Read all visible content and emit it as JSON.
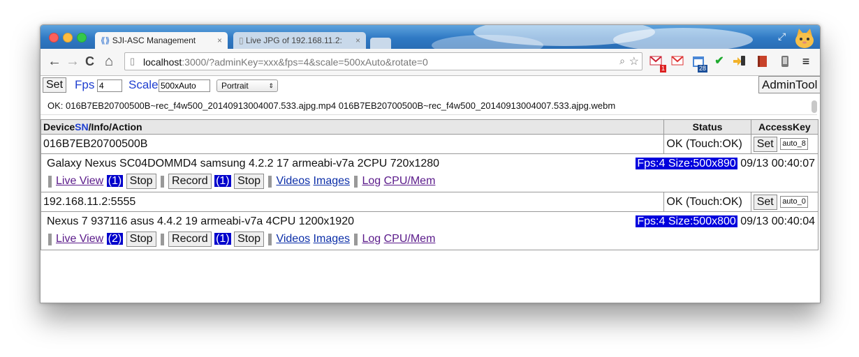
{
  "browser": {
    "tabs": [
      {
        "title": "SJI-ASC Management"
      },
      {
        "title": "Live JPG of 192.168.11.2:"
      }
    ],
    "url_host": "localhost",
    "url_rest": ":3000/?adminKey=xxx&fps=4&scale=500xAuto&rotate=0",
    "nav": {
      "back": "←",
      "forward": "→",
      "reload": "C",
      "home": "⌂"
    },
    "extensions": [
      "gmail-notifier-icon",
      "gmail-icon",
      "calendar-icon",
      "checkmark-icon",
      "phone-sync-icon",
      "book-icon",
      "phone-icon",
      "menu-icon"
    ],
    "badges": {
      "gmail": "1",
      "calendar": "28"
    }
  },
  "controls": {
    "set_label": "Set",
    "fps_label": "Fps",
    "fps_value": "4",
    "scale_label": "Scale",
    "scale_value": "500xAuto",
    "orientation": "Portrait",
    "admin_tool_label": "AdminTool"
  },
  "status_message": "OK: 016B7EB20700500B~rec_f4w500_20140913004007.533.ajpg.mp4 016B7EB20700500B~rec_f4w500_20140913004007.533.ajpg.webm",
  "table": {
    "headers": {
      "device_prefix": "Device",
      "device_sn": "SN",
      "device_suffix": "/Info/Action",
      "status": "Status",
      "access_key": "AccessKey"
    },
    "devices": [
      {
        "serial": "016B7EB20700500B",
        "status": "OK (Touch:OK)",
        "set_label": "Set",
        "access_key": "auto_8",
        "info": "Galaxy Nexus SC04DOMMD4 samsung 4.2.2 17 armeabi-v7a 2CPU 720x1280",
        "fps_size": "Fps:4 Size:500x890",
        "timestamp": "09/13 00:40:07",
        "live_view_label": "Live View",
        "live_view_count": "(1)",
        "stop_label": "Stop",
        "record_label": "Record",
        "record_count": "(1)",
        "videos_label": "Videos",
        "images_label": "Images",
        "log_label": "Log",
        "cpumem_label": "CPU/Mem"
      },
      {
        "serial": "192.168.11.2:5555",
        "status": "OK (Touch:OK)",
        "set_label": "Set",
        "access_key": "auto_0",
        "info": "Nexus 7 937116 asus 4.4.2 19 armeabi-v7a 4CPU 1200x1920",
        "fps_size": "Fps:4 Size:500x800",
        "timestamp": "09/13 00:40:04",
        "live_view_label": "Live View",
        "live_view_count": "(2)",
        "stop_label": "Stop",
        "record_label": "Record",
        "record_count": "(1)",
        "videos_label": "Videos",
        "images_label": "Images",
        "log_label": "Log",
        "cpumem_label": "CPU/Mem"
      }
    ]
  }
}
